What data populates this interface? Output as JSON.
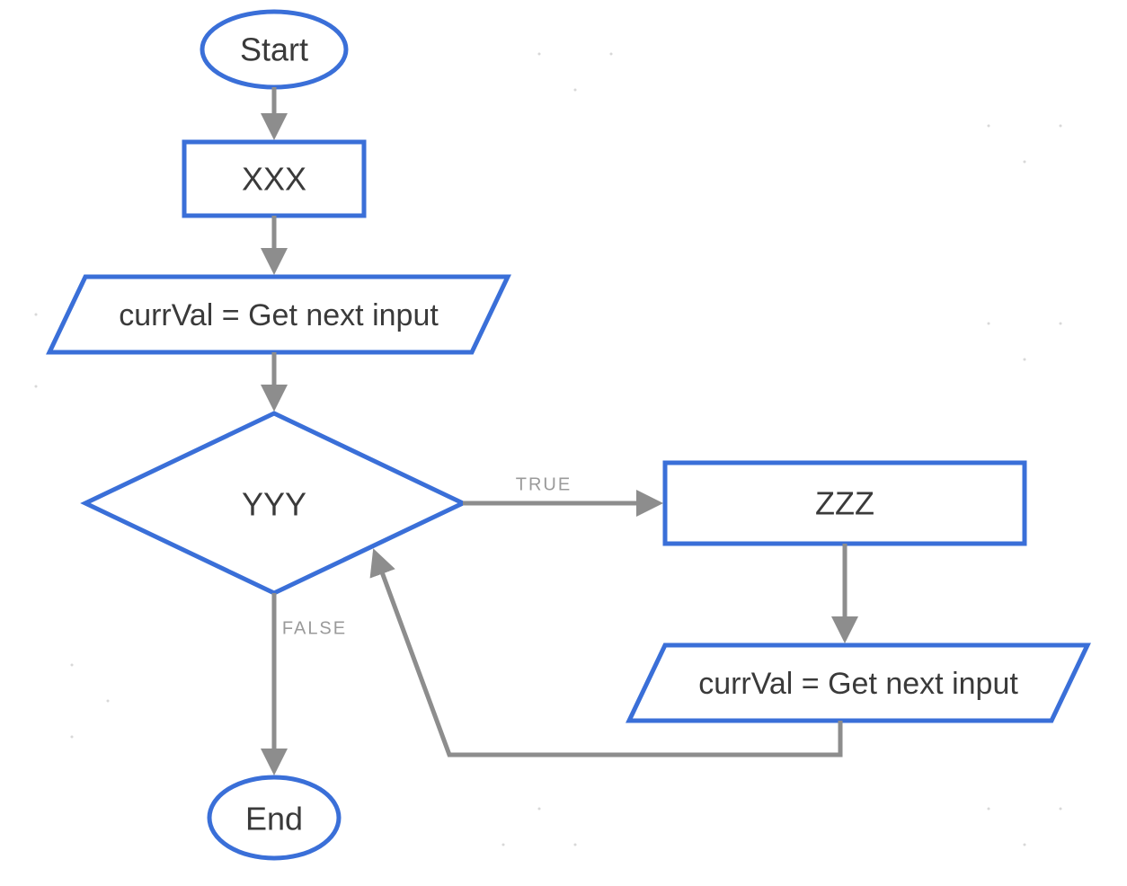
{
  "nodes": {
    "start": "Start",
    "xxx": "XXX",
    "io1": "currVal = Get next input",
    "decision": "YYY",
    "zzz": "ZZZ",
    "io2": "currVal = Get next input",
    "end": "End"
  },
  "edges": {
    "true_label": "TRUE",
    "false_label": "FALSE"
  },
  "colors": {
    "stroke": "#3a6fd8",
    "arrow": "#8d8d8d",
    "text": "#3a3a3a"
  }
}
